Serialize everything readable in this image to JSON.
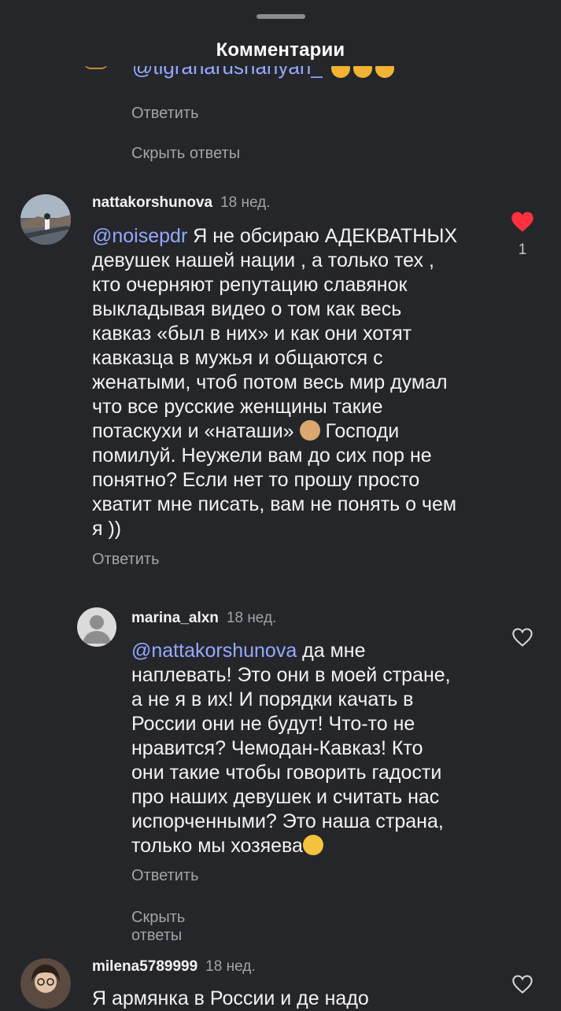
{
  "header": {
    "title": "Комментарии"
  },
  "partial_comment": {
    "text": "@tigranarushanyan_"
  },
  "links": {
    "reply": "Ответить",
    "hide_replies": "Скрыть ответы"
  },
  "comments": [
    {
      "username": "nattakorshunova",
      "time": "18 нед.",
      "mention": "@noisepdr",
      "text_before_emoji": " Я не обсираю АДЕКВАТНЫХ\nдевушек нашей нации , а только тех ,\nкто очерняют репутацию славянок\nвыкладывая видео о том как весь\nкавказ «был в них» и как они хотят\nкавказца в мужья и общаются с\nженатыми, чтоб потом весь мир думал\nчто все русские женщины такие\nпотаскухи и «наташи» ",
      "text_after_emoji": " Господи\nпомилуй. Неужели вам до сих пор не\nпонятно? Если нет то прошу просто\nхватит мне писать, вам не понять о чем\nя ))",
      "likes": "1",
      "liked": true,
      "like_color": "#ff3040"
    },
    {
      "username": "marina_alxn",
      "time": "18 нед.",
      "mention": "@nattakorshunova",
      "text_before_emoji": " да мне\nнаплевать! Это они в моей стране,\nа не я в их! И порядки качать в\nРоссии они не будут! Что-то не\nнравится? Чемодан-Кавказ! Кто\nони такие чтобы говорить гадости\nпро наших девушек и считать нас\nиспорченными? Это наша страна,\nтолько мы хозяева",
      "liked": false
    },
    {
      "username": "milena5789999",
      "time": "18 нед.",
      "text": "Я армянка в России и де надо",
      "liked": false
    }
  ],
  "icons": {
    "heart_filled": "heart-filled-icon",
    "heart_outline": "heart-outline-icon",
    "default_avatar": "default-avatar-icon",
    "emoji_laugh": "laughing-emoji-icon",
    "emoji_facepalm": "facepalm-emoji-icon",
    "emoji_kiss": "kissing-emoji-icon"
  }
}
